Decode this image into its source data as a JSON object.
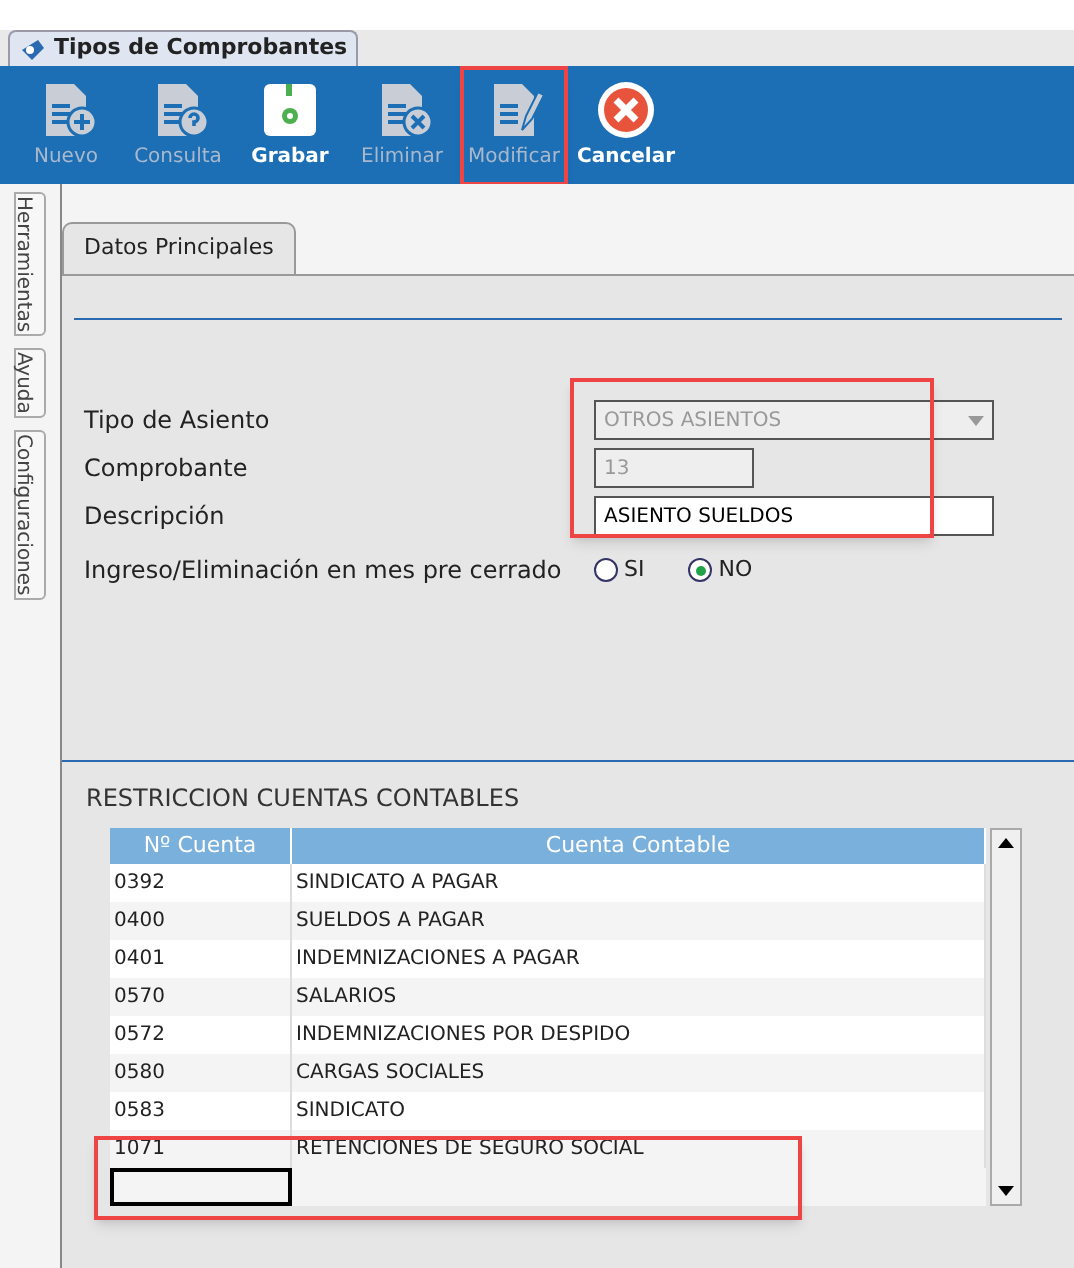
{
  "window_tab": {
    "title": "Tipos de Comprobantes"
  },
  "toolbar": [
    {
      "label": "Nuevo",
      "kind": "new",
      "disabled": true,
      "highlighted": false
    },
    {
      "label": "Consulta",
      "kind": "query",
      "disabled": true,
      "highlighted": false
    },
    {
      "label": "Grabar",
      "kind": "save",
      "disabled": false,
      "highlighted": false
    },
    {
      "label": "Eliminar",
      "kind": "delete",
      "disabled": true,
      "highlighted": false
    },
    {
      "label": "Modificar",
      "kind": "edit",
      "disabled": true,
      "highlighted": true
    },
    {
      "label": "Cancelar",
      "kind": "cancel",
      "disabled": false,
      "highlighted": false
    }
  ],
  "side_tabs": [
    "Herramientas",
    "Ayuda",
    "Configuraciones"
  ],
  "tabs": [
    {
      "label": "Datos Principales",
      "selected": true
    }
  ],
  "form": {
    "fields_highlighted": true,
    "tipo_de_asiento": {
      "label": "Tipo de Asiento",
      "value": "OTROS ASIENTOS",
      "disabled": true
    },
    "comprobante": {
      "label": "Comprobante",
      "value": "13",
      "disabled": true
    },
    "descripcion": {
      "label": "Descripción",
      "value": "ASIENTO SUELDOS",
      "disabled": false
    },
    "mes_pre_cerrado": {
      "label": "Ingreso/Eliminación en mes pre cerrado",
      "options": [
        {
          "label": "SI",
          "selected": false
        },
        {
          "label": "NO",
          "selected": true
        }
      ]
    }
  },
  "restricciones": {
    "title": "RESTRICCION CUENTAS CONTABLES",
    "new_row_highlighted": true,
    "columns": [
      "Nº Cuenta",
      "Cuenta Contable"
    ],
    "rows": [
      [
        "0392",
        "SINDICATO A PAGAR"
      ],
      [
        "0400",
        "SUELDOS A PAGAR"
      ],
      [
        "0401",
        "INDEMNIZACIONES A PAGAR"
      ],
      [
        "0570",
        "SALARIOS"
      ],
      [
        "0572",
        "INDEMNIZACIONES POR DESPIDO"
      ],
      [
        "0580",
        "CARGAS SOCIALES"
      ],
      [
        "0583",
        "SINDICATO"
      ],
      [
        "1071",
        "RETENCIONES DE SEGURO SOCIAL"
      ]
    ]
  }
}
